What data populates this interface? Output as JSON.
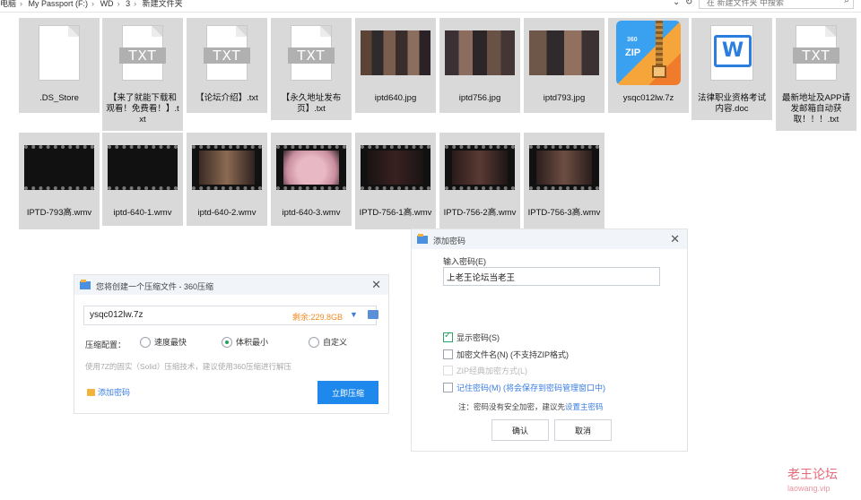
{
  "path": {
    "crumbs": [
      "电脑",
      "My Passport (F:)",
      "WD",
      "3",
      "新建文件夹"
    ],
    "search_placeholder": "在 新建文件夹 中搜索"
  },
  "files": [
    {
      "name": ".DS_Store",
      "kind": "blank"
    },
    {
      "name": "【来了就能下载和观看！免费看！】.txt",
      "kind": "txt"
    },
    {
      "name": "【论坛介绍】.txt",
      "kind": "txt"
    },
    {
      "name": "【永久地址发布页】.txt",
      "kind": "txt"
    },
    {
      "name": "iptd640.jpg",
      "kind": "photo"
    },
    {
      "name": "iptd756.jpg",
      "kind": "photo"
    },
    {
      "name": "iptd793.jpg",
      "kind": "photo"
    },
    {
      "name": "ysqc012lw.7z",
      "kind": "zip"
    },
    {
      "name": "法律职业资格考试内容.doc",
      "kind": "doc"
    },
    {
      "name": "最新地址及APP请发邮箱自动获取！！！.txt",
      "kind": "txt"
    },
    {
      "name": "IPTD-793高.wmv",
      "kind": "video"
    },
    {
      "name": "iptd-640-1.wmv",
      "kind": "video"
    },
    {
      "name": "iptd-640-2.wmv",
      "kind": "video"
    },
    {
      "name": "iptd-640-3.wmv",
      "kind": "video"
    },
    {
      "name": "IPTD-756-1高.wmv",
      "kind": "video"
    },
    {
      "name": "IPTD-756-2高.wmv",
      "kind": "video"
    },
    {
      "name": "IPTD-756-3高.wmv",
      "kind": "video"
    }
  ],
  "icons": {
    "txt_badge": "TXT",
    "zip_badge": "ZIP",
    "zip_brand": "360",
    "doc_letter": "W"
  },
  "compress_dialog": {
    "title": "您将创建一个压缩文件 - 360压缩",
    "filename": "ysqc012lw.7z",
    "remaining": "剩余:229.8GB",
    "config_label": "压缩配置：",
    "options": [
      "速度最快",
      "体积最小",
      "自定义"
    ],
    "selected_option": "体积最小",
    "note": "使用7Z的固实（Solid）压缩技术，建议使用360压缩进行解压",
    "add_password": "添加密码",
    "start_button": "立即压缩"
  },
  "password_dialog": {
    "title": "添加密码",
    "input_label": "输入密码(E)",
    "password_value": "上老王论坛当老王",
    "show_password": "显示密码(S)",
    "show_password_checked": true,
    "encrypt_filenames": "加密文件名(N) (不支持ZIP格式)",
    "zip_classic": "ZIP经典加密方式(L)",
    "remember": "记住密码(M) (将会保存到密码管理窗口中)",
    "note_prefix": "注：密码没有安全加密，建议先",
    "note_link": "设置主密码",
    "ok_button": "确认",
    "cancel_button": "取消"
  },
  "watermark": {
    "text": "老王论坛",
    "sub": "laowang.vip"
  }
}
